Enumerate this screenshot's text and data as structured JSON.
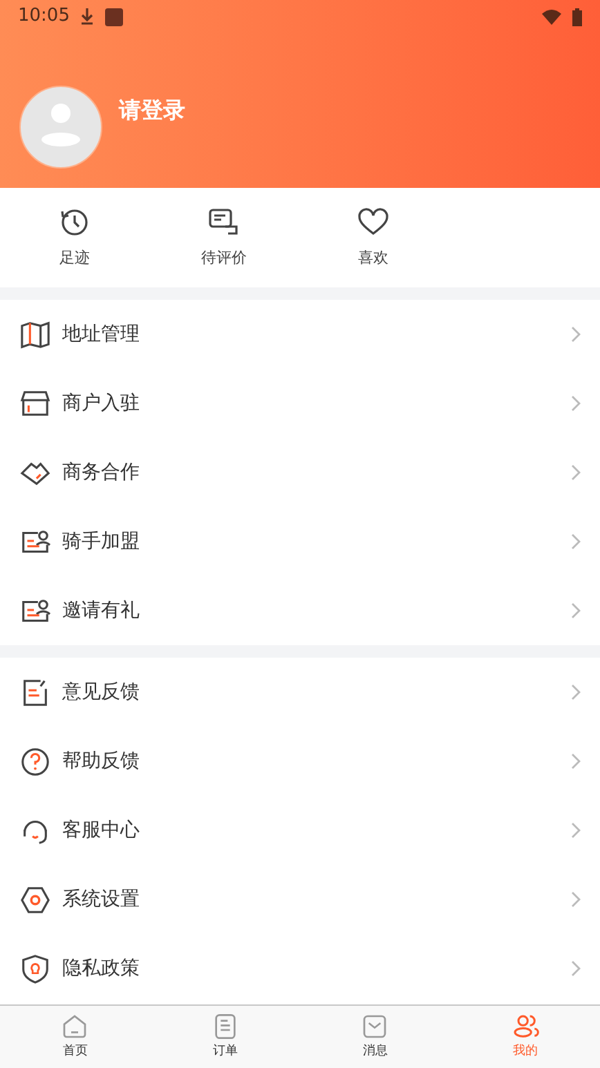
{
  "status_bar": {
    "time": "10:05"
  },
  "profile": {
    "name": "请登录"
  },
  "shortcuts": [
    {
      "kind": "history",
      "label": "足迹"
    },
    {
      "kind": "review",
      "label": "待评价"
    },
    {
      "kind": "heart",
      "label": "喜欢"
    }
  ],
  "menu_groups": [
    [
      {
        "kind": "map",
        "label": "地址管理"
      },
      {
        "kind": "store",
        "label": "商户入驻"
      },
      {
        "kind": "handshake",
        "label": "商务合作"
      },
      {
        "kind": "card",
        "label": "骑手加盟"
      },
      {
        "kind": "card",
        "label": "邀请有礼"
      }
    ],
    [
      {
        "kind": "note",
        "label": "意见反馈"
      },
      {
        "kind": "help",
        "label": "帮助反馈"
      },
      {
        "kind": "headset",
        "label": "客服中心"
      },
      {
        "kind": "settings",
        "label": "系统设置"
      },
      {
        "kind": "shield",
        "label": "隐私政策"
      }
    ]
  ],
  "tab_bar": [
    {
      "kind": "home",
      "label": "首页",
      "selected": false
    },
    {
      "kind": "order",
      "label": "订单",
      "selected": false
    },
    {
      "kind": "message",
      "label": "消息",
      "selected": false
    },
    {
      "kind": "user",
      "label": "我的",
      "selected": true
    }
  ]
}
